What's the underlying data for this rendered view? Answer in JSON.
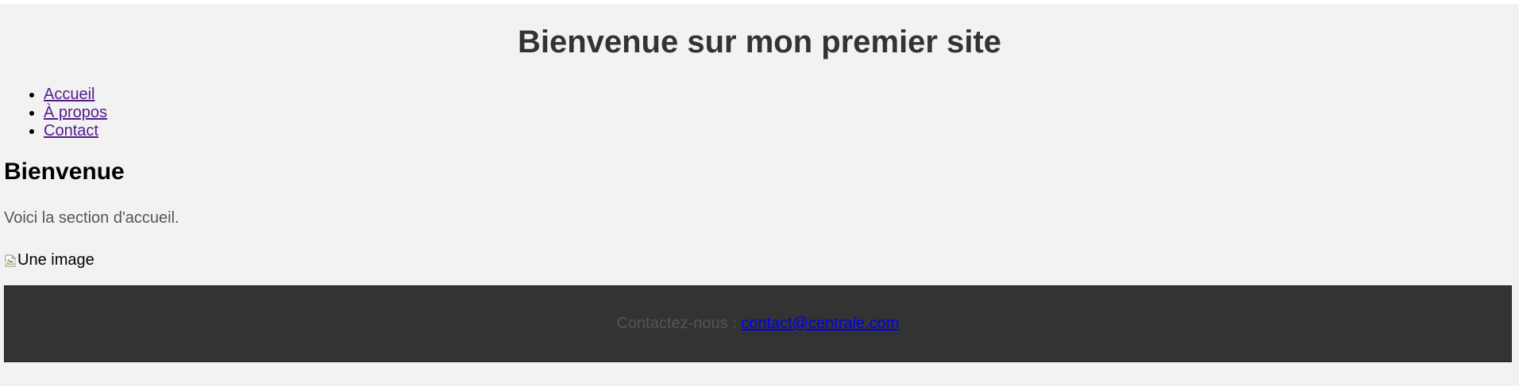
{
  "header": {
    "title": "Bienvenue sur mon premier site"
  },
  "nav": {
    "items": [
      {
        "label": "Accueil"
      },
      {
        "label": "À propos"
      },
      {
        "label": "Contact"
      }
    ],
    "link_color": "#551a8b"
  },
  "main": {
    "heading": "Bienvenue",
    "paragraph": "Voici la section d'accueil.",
    "image_alt": "Une image"
  },
  "footer": {
    "text": "Contactez-nous : ",
    "email": "contact@centrale.com",
    "background": "#333333",
    "link_color": "#0000ee"
  },
  "colors": {
    "page_background": "#f2f2f2",
    "title": "#333333"
  }
}
